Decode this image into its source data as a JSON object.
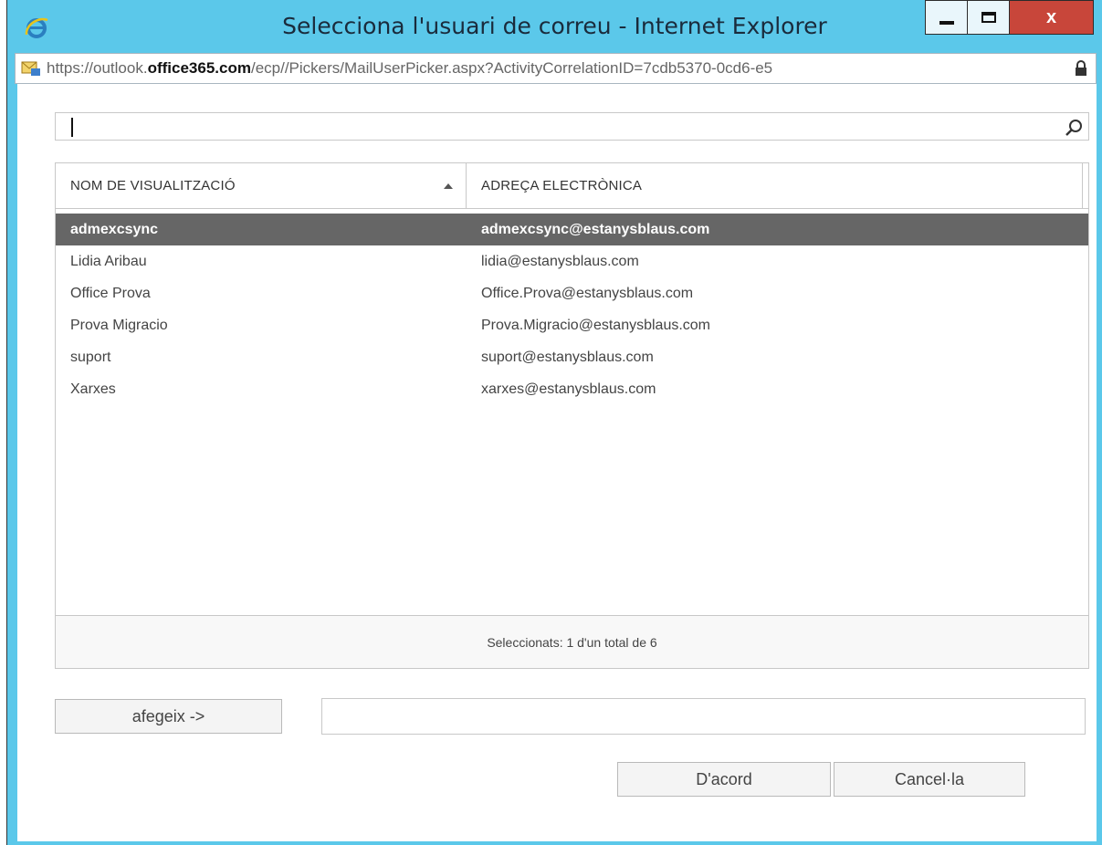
{
  "window": {
    "title": "Selecciona l'usuari de correu - Internet Explorer",
    "close_glyph": "x",
    "colors": {
      "frame": "#5bc8ea",
      "close": "#c8463a",
      "selected_row": "#666666"
    }
  },
  "address_bar": {
    "url_prefix": "https://outlook.",
    "url_domain": "office365.com",
    "url_path": "/ecp//Pickers/MailUserPicker.aspx?ActivityCorrelationID=7cdb5370-0cd6-e5",
    "page_icon": "mail-page-icon",
    "secure_icon": "lock-icon"
  },
  "search": {
    "value": "",
    "icon": "search-icon"
  },
  "grid": {
    "columns": [
      {
        "label": "NOM DE VISUALITZACIÓ",
        "sort": "ascending"
      },
      {
        "label": "ADREÇA ELECTRÒNICA"
      }
    ],
    "rows": [
      {
        "name": "admexcsync",
        "email": "admexcsync@estanysblaus.com",
        "selected": true
      },
      {
        "name": "Lidia Aribau",
        "email": "lidia@estanysblaus.com",
        "selected": false
      },
      {
        "name": "Office Prova",
        "email": "Office.Prova@estanysblaus.com",
        "selected": false
      },
      {
        "name": "Prova Migracio",
        "email": "Prova.Migracio@estanysblaus.com",
        "selected": false
      },
      {
        "name": "suport",
        "email": "suport@estanysblaus.com",
        "selected": false
      },
      {
        "name": "Xarxes",
        "email": "xarxes@estanysblaus.com",
        "selected": false
      }
    ],
    "footer": "Seleccionats: 1 d'un total de 6"
  },
  "actions": {
    "add_label": "afegeix ->",
    "added_value": "",
    "ok_label": "D'acord",
    "cancel_label": "Cancel·la"
  }
}
